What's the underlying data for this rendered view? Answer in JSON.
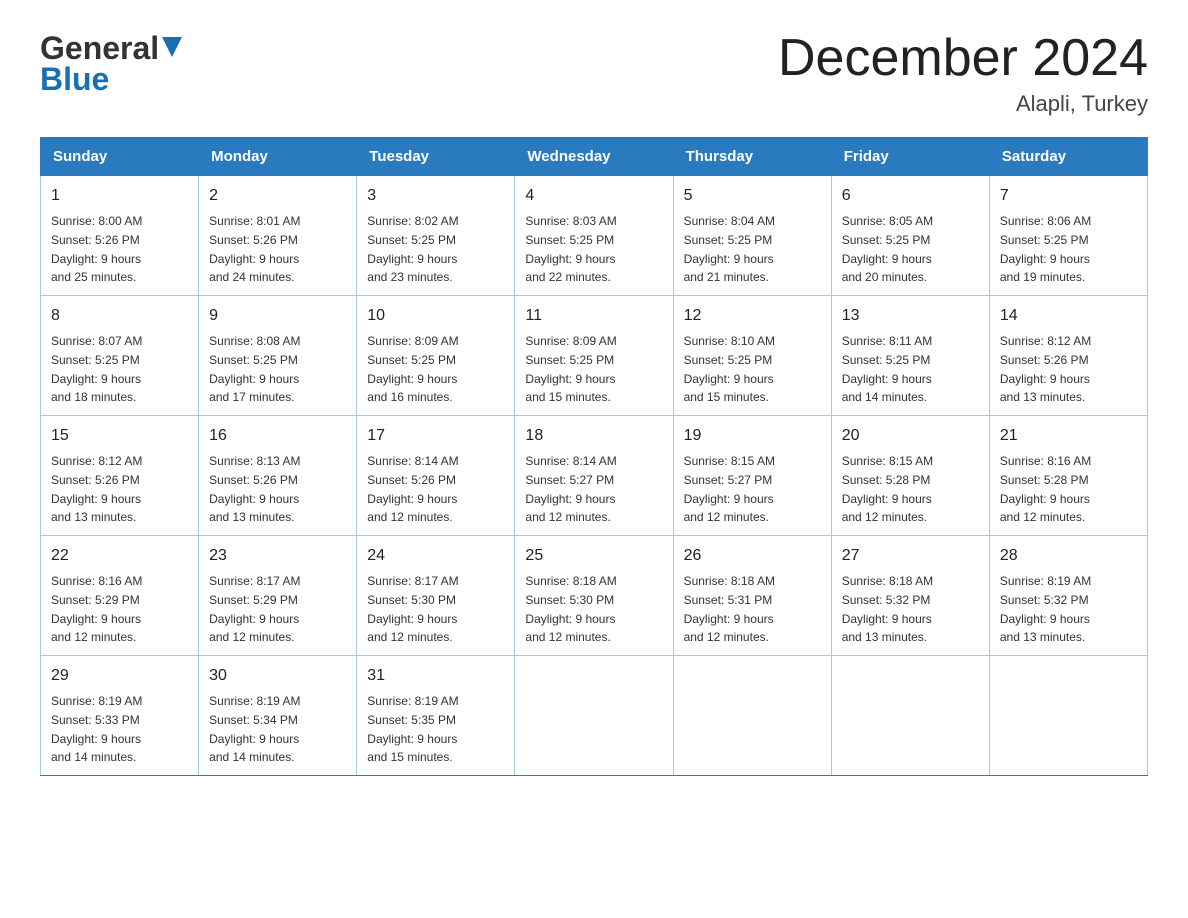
{
  "header": {
    "logo_line1": "General",
    "logo_line2": "Blue",
    "title": "December 2024",
    "subtitle": "Alapli, Turkey"
  },
  "days_of_week": [
    "Sunday",
    "Monday",
    "Tuesday",
    "Wednesday",
    "Thursday",
    "Friday",
    "Saturday"
  ],
  "weeks": [
    [
      {
        "day": "1",
        "sunrise": "8:00 AM",
        "sunset": "5:26 PM",
        "daylight": "9 hours and 25 minutes."
      },
      {
        "day": "2",
        "sunrise": "8:01 AM",
        "sunset": "5:26 PM",
        "daylight": "9 hours and 24 minutes."
      },
      {
        "day": "3",
        "sunrise": "8:02 AM",
        "sunset": "5:25 PM",
        "daylight": "9 hours and 23 minutes."
      },
      {
        "day": "4",
        "sunrise": "8:03 AM",
        "sunset": "5:25 PM",
        "daylight": "9 hours and 22 minutes."
      },
      {
        "day": "5",
        "sunrise": "8:04 AM",
        "sunset": "5:25 PM",
        "daylight": "9 hours and 21 minutes."
      },
      {
        "day": "6",
        "sunrise": "8:05 AM",
        "sunset": "5:25 PM",
        "daylight": "9 hours and 20 minutes."
      },
      {
        "day": "7",
        "sunrise": "8:06 AM",
        "sunset": "5:25 PM",
        "daylight": "9 hours and 19 minutes."
      }
    ],
    [
      {
        "day": "8",
        "sunrise": "8:07 AM",
        "sunset": "5:25 PM",
        "daylight": "9 hours and 18 minutes."
      },
      {
        "day": "9",
        "sunrise": "8:08 AM",
        "sunset": "5:25 PM",
        "daylight": "9 hours and 17 minutes."
      },
      {
        "day": "10",
        "sunrise": "8:09 AM",
        "sunset": "5:25 PM",
        "daylight": "9 hours and 16 minutes."
      },
      {
        "day": "11",
        "sunrise": "8:09 AM",
        "sunset": "5:25 PM",
        "daylight": "9 hours and 15 minutes."
      },
      {
        "day": "12",
        "sunrise": "8:10 AM",
        "sunset": "5:25 PM",
        "daylight": "9 hours and 15 minutes."
      },
      {
        "day": "13",
        "sunrise": "8:11 AM",
        "sunset": "5:25 PM",
        "daylight": "9 hours and 14 minutes."
      },
      {
        "day": "14",
        "sunrise": "8:12 AM",
        "sunset": "5:26 PM",
        "daylight": "9 hours and 13 minutes."
      }
    ],
    [
      {
        "day": "15",
        "sunrise": "8:12 AM",
        "sunset": "5:26 PM",
        "daylight": "9 hours and 13 minutes."
      },
      {
        "day": "16",
        "sunrise": "8:13 AM",
        "sunset": "5:26 PM",
        "daylight": "9 hours and 13 minutes."
      },
      {
        "day": "17",
        "sunrise": "8:14 AM",
        "sunset": "5:26 PM",
        "daylight": "9 hours and 12 minutes."
      },
      {
        "day": "18",
        "sunrise": "8:14 AM",
        "sunset": "5:27 PM",
        "daylight": "9 hours and 12 minutes."
      },
      {
        "day": "19",
        "sunrise": "8:15 AM",
        "sunset": "5:27 PM",
        "daylight": "9 hours and 12 minutes."
      },
      {
        "day": "20",
        "sunrise": "8:15 AM",
        "sunset": "5:28 PM",
        "daylight": "9 hours and 12 minutes."
      },
      {
        "day": "21",
        "sunrise": "8:16 AM",
        "sunset": "5:28 PM",
        "daylight": "9 hours and 12 minutes."
      }
    ],
    [
      {
        "day": "22",
        "sunrise": "8:16 AM",
        "sunset": "5:29 PM",
        "daylight": "9 hours and 12 minutes."
      },
      {
        "day": "23",
        "sunrise": "8:17 AM",
        "sunset": "5:29 PM",
        "daylight": "9 hours and 12 minutes."
      },
      {
        "day": "24",
        "sunrise": "8:17 AM",
        "sunset": "5:30 PM",
        "daylight": "9 hours and 12 minutes."
      },
      {
        "day": "25",
        "sunrise": "8:18 AM",
        "sunset": "5:30 PM",
        "daylight": "9 hours and 12 minutes."
      },
      {
        "day": "26",
        "sunrise": "8:18 AM",
        "sunset": "5:31 PM",
        "daylight": "9 hours and 12 minutes."
      },
      {
        "day": "27",
        "sunrise": "8:18 AM",
        "sunset": "5:32 PM",
        "daylight": "9 hours and 13 minutes."
      },
      {
        "day": "28",
        "sunrise": "8:19 AM",
        "sunset": "5:32 PM",
        "daylight": "9 hours and 13 minutes."
      }
    ],
    [
      {
        "day": "29",
        "sunrise": "8:19 AM",
        "sunset": "5:33 PM",
        "daylight": "9 hours and 14 minutes."
      },
      {
        "day": "30",
        "sunrise": "8:19 AM",
        "sunset": "5:34 PM",
        "daylight": "9 hours and 14 minutes."
      },
      {
        "day": "31",
        "sunrise": "8:19 AM",
        "sunset": "5:35 PM",
        "daylight": "9 hours and 15 minutes."
      },
      null,
      null,
      null,
      null
    ]
  ],
  "labels": {
    "sunrise": "Sunrise:",
    "sunset": "Sunset:",
    "daylight": "Daylight:"
  }
}
